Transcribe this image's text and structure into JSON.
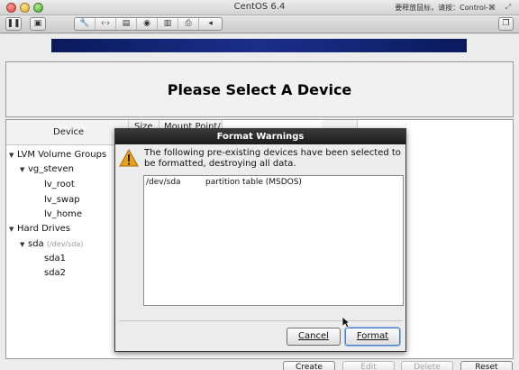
{
  "window": {
    "title": "CentOS 6.4",
    "release_hint": "要释放鼠标，请按：Control-⌘"
  },
  "installer": {
    "page_title": "Please Select A Device",
    "columns": {
      "device": "Device",
      "size": "Size",
      "mount": "Mount Point/"
    },
    "tree": [
      {
        "label": "LVM Volume Groups",
        "level": 0,
        "expanded": true
      },
      {
        "label": "vg_steven",
        "level": 1,
        "expanded": true
      },
      {
        "label": "lv_root",
        "level": 2
      },
      {
        "label": "lv_swap",
        "level": 2
      },
      {
        "label": "lv_home",
        "level": 2
      },
      {
        "label": "Hard Drives",
        "level": 0,
        "expanded": true
      },
      {
        "label": "sda",
        "sub": "(/dev/sda)",
        "level": 1,
        "expanded": true
      },
      {
        "label": "sda1",
        "level": 2
      },
      {
        "label": "sda2",
        "level": 2
      }
    ],
    "buttons": {
      "create": "Create",
      "edit": "Edit",
      "delete": "Delete",
      "reset": "Reset"
    }
  },
  "dialog": {
    "title": "Format Warnings",
    "message": "The following pre-existing devices have been selected to be formatted, destroying all data.",
    "rows": [
      {
        "device": "/dev/sda",
        "description": "partition table (MSDOS)"
      }
    ],
    "cancel_label": "Cancel",
    "format_label": "Format",
    "warning_icon": "warning-triangle-icon"
  },
  "colors": {
    "banner": "#1b2f8a",
    "dialog_title_bg": "#2a2a2a",
    "warning": "#e8a21c"
  }
}
